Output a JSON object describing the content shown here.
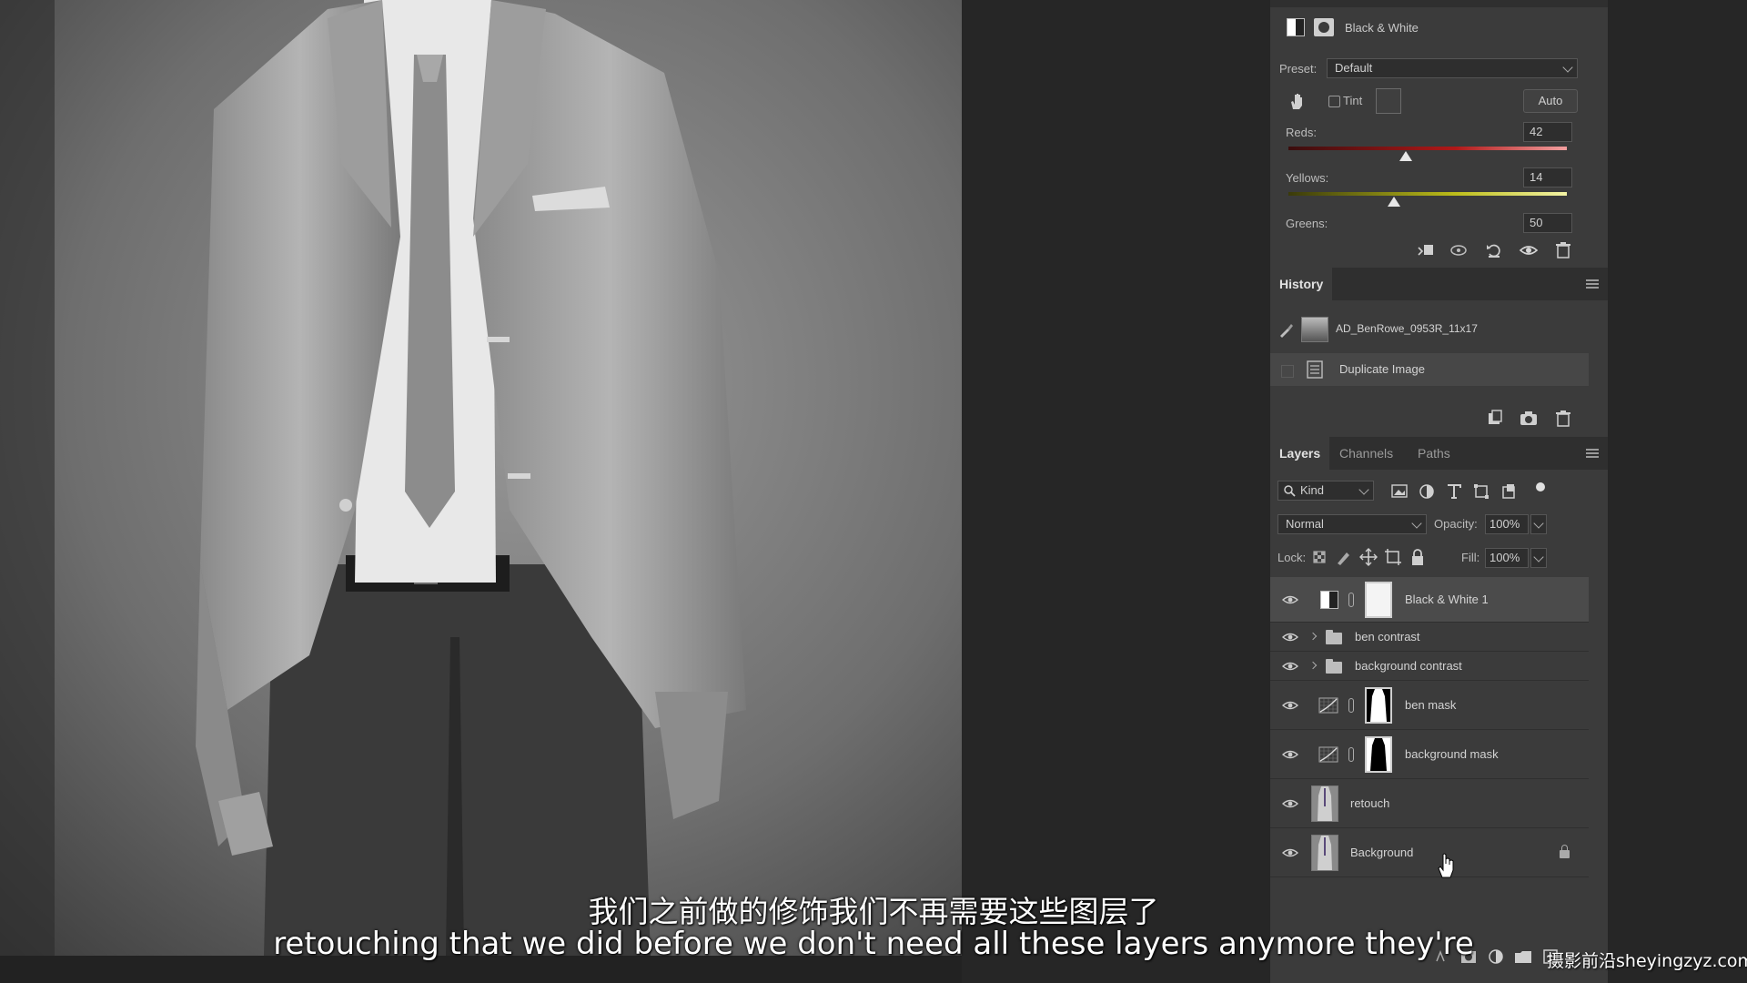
{
  "properties": {
    "title": "Black & White",
    "preset_label": "Preset:",
    "preset_value": "Default",
    "tint_label": "Tint",
    "tint_checked": false,
    "auto_label": "Auto",
    "sliders": [
      {
        "label": "Reds:",
        "value": "42",
        "level": 0.42
      },
      {
        "label": "Yellows:",
        "value": "14",
        "level": 0.38
      },
      {
        "label": "Greens:",
        "value": "50"
      }
    ],
    "footer_icons": [
      "clip-to-layer-icon",
      "view-previous-icon",
      "reset-icon",
      "visibility-eye-icon",
      "trash-icon"
    ]
  },
  "history": {
    "tab_label": "History",
    "items": [
      {
        "label": "AD_BenRowe_0953R_11x17",
        "type": "snapshot"
      },
      {
        "label": "Duplicate Image",
        "type": "state",
        "selected": true
      }
    ],
    "footer_icons": [
      "new-document-from-state-icon",
      "camera-icon",
      "trash-icon"
    ]
  },
  "layers_panel": {
    "tabs": [
      {
        "label": "Layers",
        "active": true
      },
      {
        "label": "Channels",
        "active": false
      },
      {
        "label": "Paths",
        "active": false
      }
    ],
    "filter_label": "Kind",
    "blend_mode": "Normal",
    "opacity_label": "Opacity:",
    "opacity_value": "100%",
    "lock_label": "Lock:",
    "fill_label": "Fill:",
    "fill_value": "100%",
    "layers": [
      {
        "name": "Black & White 1",
        "kind": "adjustment",
        "selected": true
      },
      {
        "name": "ben contrast",
        "kind": "group"
      },
      {
        "name": "background contrast",
        "kind": "group"
      },
      {
        "name": "ben mask",
        "kind": "curves-mask"
      },
      {
        "name": "background mask",
        "kind": "curves-mask"
      },
      {
        "name": "retouch",
        "kind": "pixel"
      },
      {
        "name": "Background",
        "kind": "pixel",
        "locked": true
      }
    ]
  },
  "subtitles": {
    "zh": "我们之前做的修饰我们不再需要这些图层了",
    "en": "retouching that we did before we don't need all these layers anymore they're"
  },
  "watermark": "摄影前沿sheyingzyz.com",
  "colors": {
    "panel_bg": "#3b3b3b",
    "tab_bar_bg": "#2f2f2f",
    "selected_row": "#4b4b4b",
    "workspace": "#262626"
  }
}
